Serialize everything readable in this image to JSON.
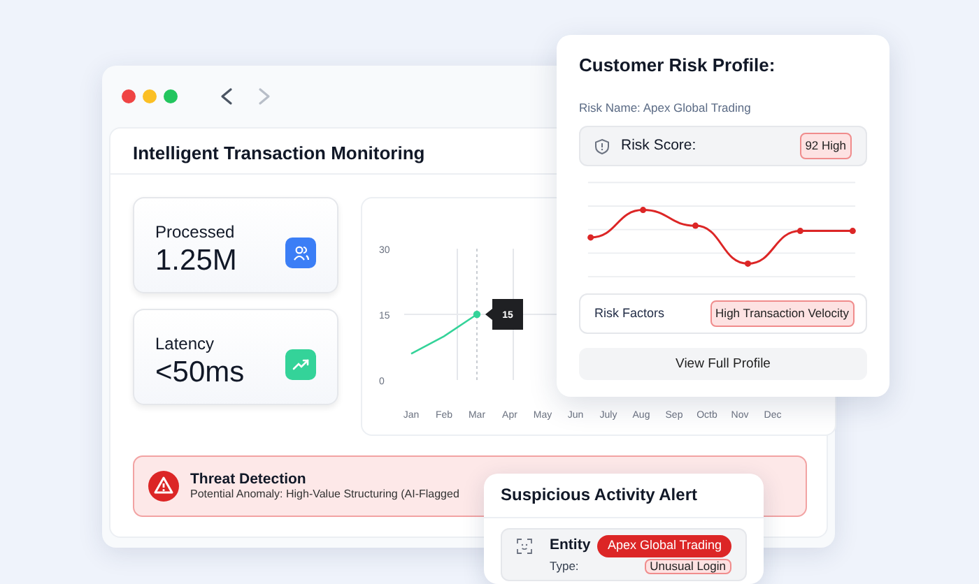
{
  "nav": [
    {
      "kind": "back",
      "disabled": false
    },
    {
      "kind": "forward",
      "disabled": true
    }
  ],
  "panel": {
    "title": "Intelligent Transaction Monitoring"
  },
  "stats": [
    {
      "label": "Processed",
      "value": "1.25M",
      "color": "#3b7ef6"
    },
    {
      "label": "Latency",
      "value": "<50ms",
      "color": "#34d399"
    }
  ],
  "chart": {
    "chart_data": {
      "type": "line",
      "categories": [
        "Jan",
        "Feb",
        "Mar",
        "Apr",
        "May",
        "Jun",
        "July",
        "Aug",
        "Sep",
        "Octb",
        "Nov",
        "Dec"
      ],
      "series": [
        {
          "color": "#34d399",
          "values": [
            6,
            10,
            15,
            null,
            null,
            null,
            null,
            null,
            null,
            null,
            null,
            null
          ]
        }
      ],
      "ylim": [
        0,
        30
      ],
      "yticks": [
        0,
        15,
        30
      ],
      "ref_lines": [
        {
          "axis": "x",
          "value": "Mar"
        },
        {
          "axis": "y",
          "value": 15
        }
      ],
      "annotations": [
        {
          "x": "Mar",
          "y": 15,
          "text": "15"
        }
      ]
    }
  },
  "threat_alert": {
    "title": "Threat Detection",
    "message": "Potential Anomaly: High-Value Structuring (AI-Flagged"
  },
  "risk_profile": {
    "title": "Customer Risk Profile:",
    "risk_name": "Risk Name: Apex Global Trading",
    "score_label": "Risk Score:",
    "score_badge": "92 High",
    "factors_label": "Risk Factors",
    "factor_badge": "High Transaction Velocity",
    "button": "View Full Profile"
  },
  "suspicious_alert": {
    "title": "Suspicious Activity Alert",
    "entity_label": "Entity",
    "entity_badge": "Apex Global Trading",
    "type_label": "Type:",
    "type_badge": "Unusual Login"
  }
}
